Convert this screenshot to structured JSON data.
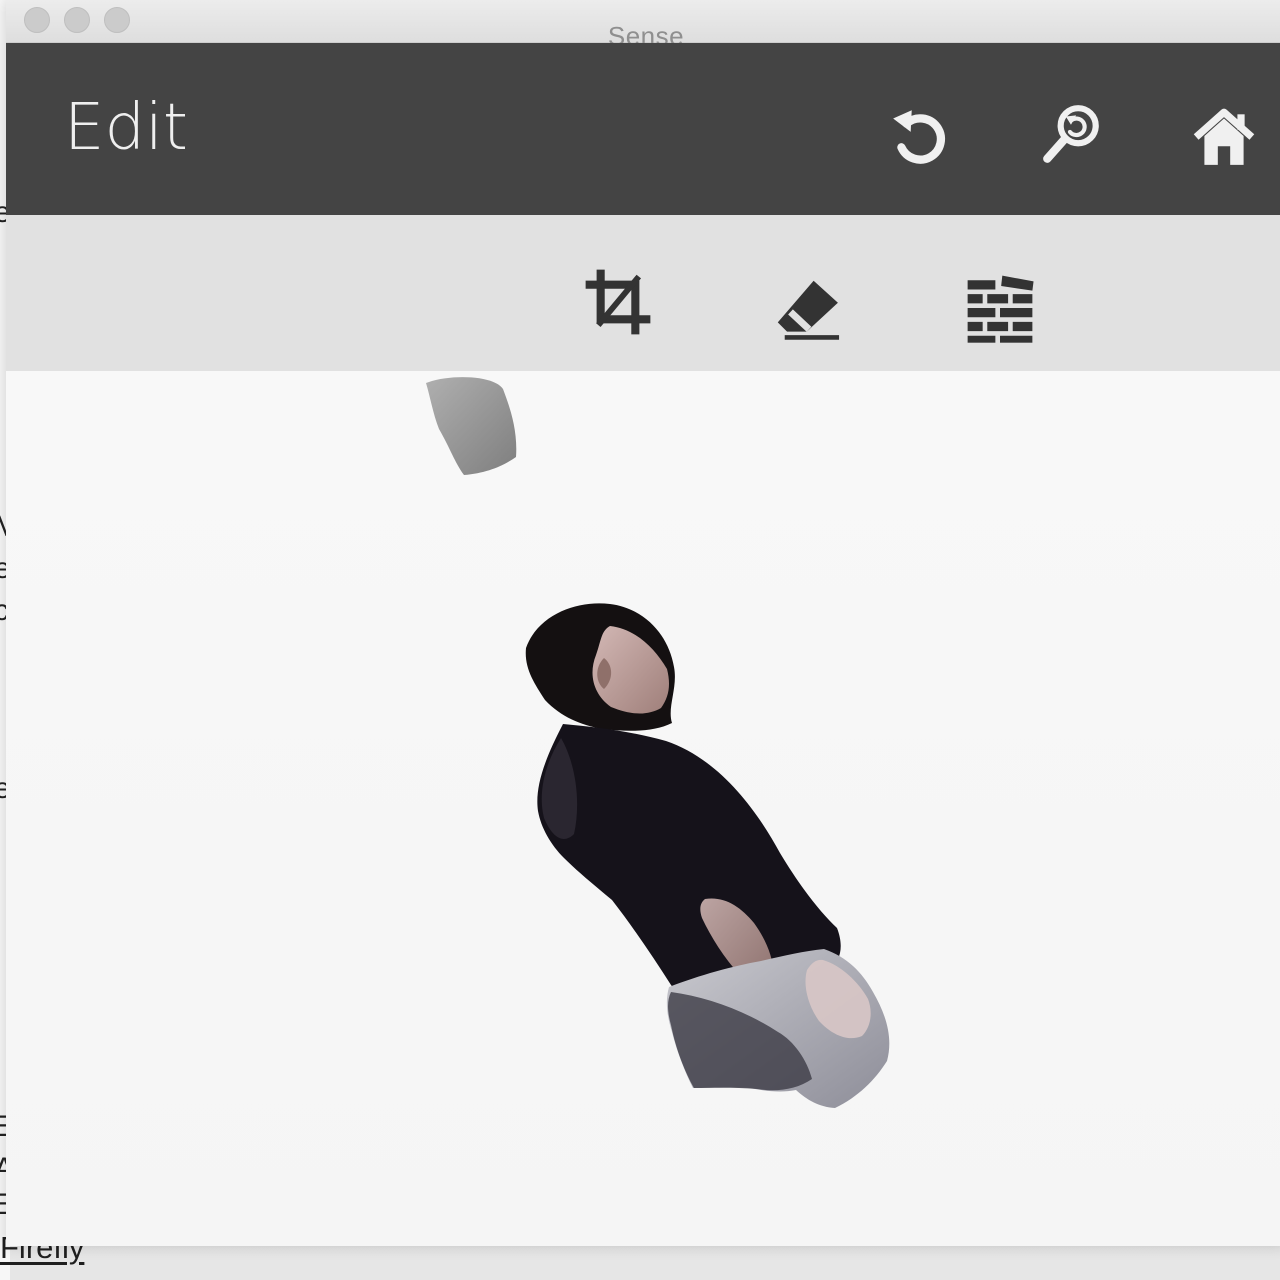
{
  "window": {
    "title": "Sense"
  },
  "header": {
    "title": "Edit",
    "actions": [
      {
        "name": "reset-view-button",
        "icon": "reset-icon"
      },
      {
        "name": "zoom-reset-button",
        "icon": "zoom-reset-icon"
      },
      {
        "name": "home-button",
        "icon": "home-icon"
      }
    ]
  },
  "tools": [
    {
      "name": "crop-button",
      "icon": "crop-icon"
    },
    {
      "name": "erase-button",
      "icon": "eraser-icon"
    },
    {
      "name": "solidify-button",
      "icon": "brick-wall-icon"
    }
  ],
  "background": {
    "link_text": "Firefly"
  },
  "colors": {
    "header_background": "#444444",
    "toolbar_background": "#e1e1e1",
    "canvas_background": "#f6f6f6",
    "icon_light": "#f0f0f0",
    "icon_dark": "#333333"
  }
}
